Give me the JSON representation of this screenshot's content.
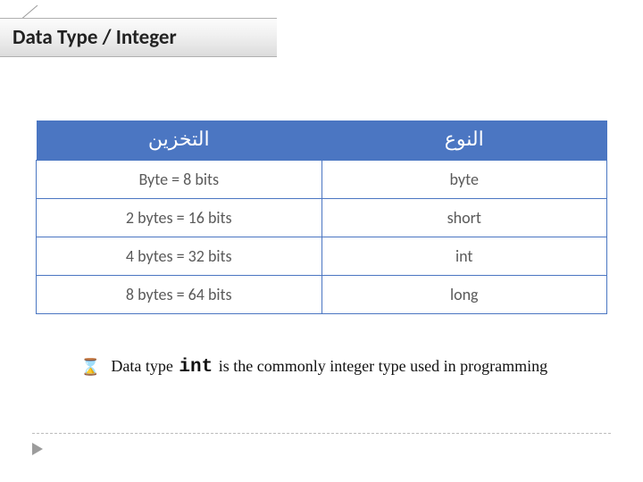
{
  "title": "Data Type / Integer",
  "table": {
    "headers": {
      "storage": "التخزين",
      "type": "النوع"
    },
    "rows": [
      {
        "storage": "Byte = 8 bits",
        "type": "byte"
      },
      {
        "storage": "2 bytes = 16 bits",
        "type": "short"
      },
      {
        "storage": "4 bytes = 32 bits",
        "type": "int"
      },
      {
        "storage": "8 bytes = 64 bits",
        "type": "long"
      }
    ]
  },
  "note": {
    "bullet_icon": "hourglass-icon",
    "pre": "Data type ",
    "keyword": "int",
    "post": " is the commonly integer type used in programming"
  },
  "chart_data": {
    "type": "table",
    "title": "Data Type / Integer",
    "columns": [
      "التخزين",
      "النوع"
    ],
    "rows": [
      [
        "Byte = 8 bits",
        "byte"
      ],
      [
        "2 bytes = 16 bits",
        "short"
      ],
      [
        "4 bytes = 32 bits",
        "int"
      ],
      [
        "8 bytes = 64 bits",
        "long"
      ]
    ]
  }
}
